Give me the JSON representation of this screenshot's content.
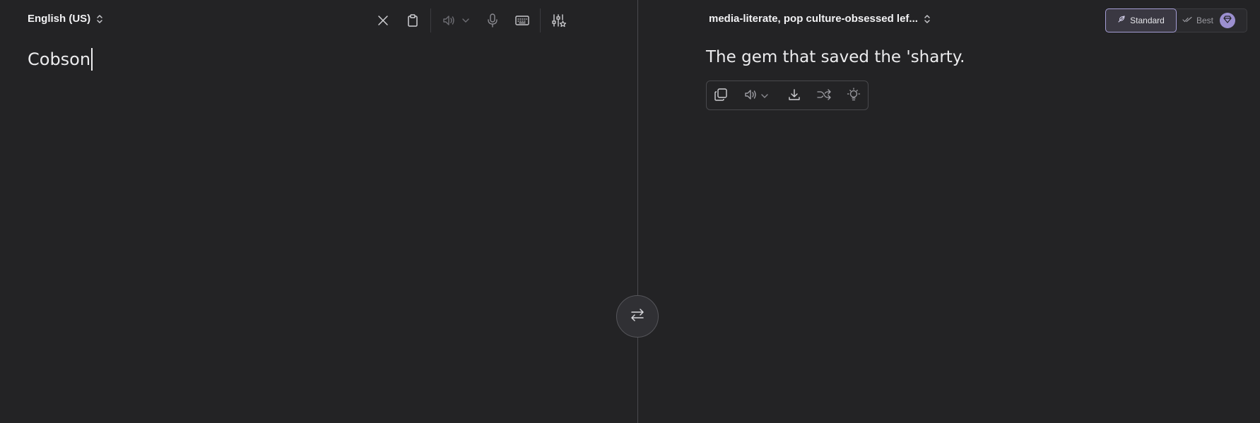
{
  "source": {
    "language_label": "English (US)",
    "text": "Cobson",
    "toolbar": {
      "clear": "close-icon",
      "paste": "clipboard-icon",
      "speak": "speaker-icon",
      "voice_menu": "chevron-down-icon",
      "dictate": "microphone-icon",
      "keyboard": "keyboard-icon",
      "settings": "sliders-star-icon"
    }
  },
  "target": {
    "style_label": "media-literate, pop culture-obsessed lef...",
    "text": "The gem that saved the 'sharty.",
    "actions": {
      "copy": "copy-icon",
      "speak": "speaker-icon",
      "voice_menu": "chevron-down-icon",
      "download": "download-icon",
      "shuffle": "shuffle-icon",
      "explain": "lightbulb-icon"
    }
  },
  "mode": {
    "standard_label": "Standard",
    "best_label": "Best",
    "selected": "Standard",
    "standard_icon": "feather-icon",
    "best_icon": "double-check-icon",
    "premium_icon": "gem-icon"
  },
  "swap": {
    "icon": "swap-arrows-icon"
  },
  "colors": {
    "background": "#232325",
    "accent": "#a59ed6",
    "premium_badge": "#9b8fcf",
    "text": "#ececee",
    "divider": "#4a4a4e"
  }
}
